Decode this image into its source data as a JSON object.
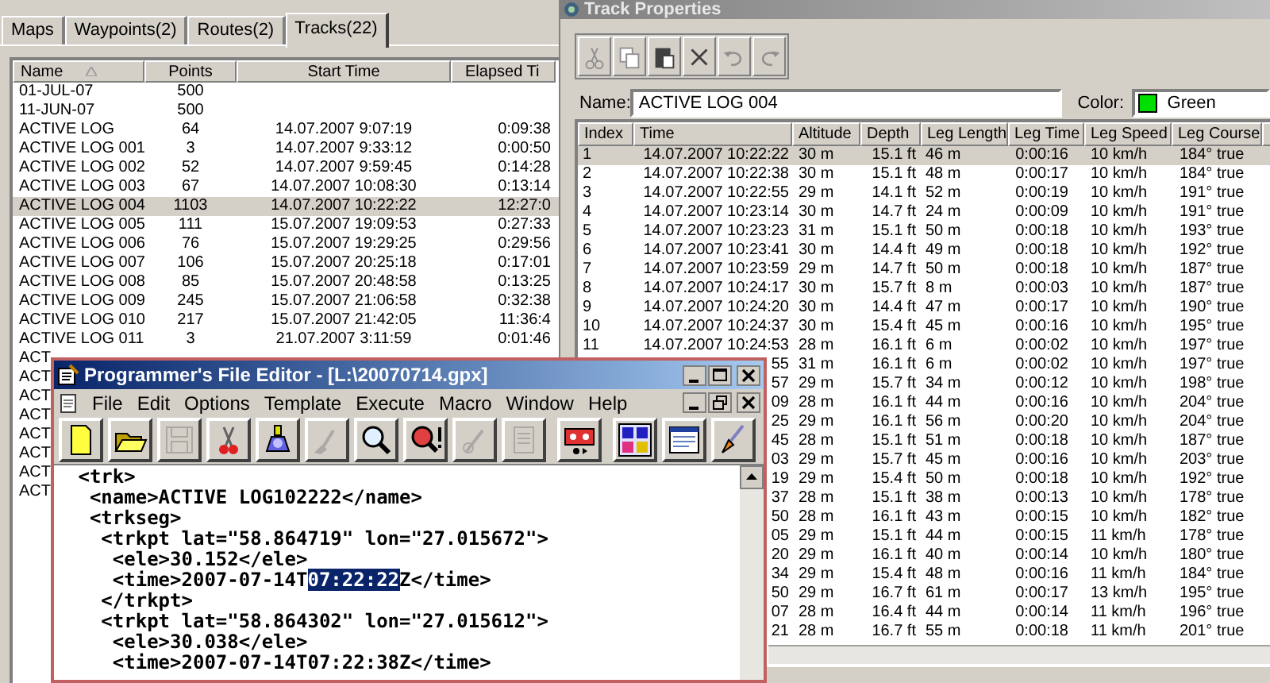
{
  "tracks_window": {
    "tabs": [
      {
        "label": "Maps",
        "selected": false
      },
      {
        "label": "Waypoints(2)",
        "selected": false
      },
      {
        "label": "Routes(2)",
        "selected": false
      },
      {
        "label": "Tracks(22)",
        "selected": true
      }
    ],
    "columns": [
      "Name",
      "Points",
      "Start Time",
      "Elapsed Ti"
    ],
    "rows": [
      {
        "name": "01-JUL-07",
        "points": "500",
        "selected": false
      },
      {
        "name": "11-JUN-07",
        "points": "500",
        "selected": false
      },
      {
        "name": "ACTIVE LOG",
        "points": "64",
        "start": "14.07.2007 9:07:19",
        "elapsed": "0:09:38",
        "selected": false
      },
      {
        "name": "ACTIVE LOG 001",
        "points": "3",
        "start": "14.07.2007 9:33:12",
        "elapsed": "0:00:50",
        "selected": false
      },
      {
        "name": "ACTIVE LOG 002",
        "points": "52",
        "start": "14.07.2007 9:59:45",
        "elapsed": "0:14:28",
        "selected": false
      },
      {
        "name": "ACTIVE LOG 003",
        "points": "67",
        "start": "14.07.2007 10:08:30",
        "elapsed": "0:13:14",
        "selected": false
      },
      {
        "name": "ACTIVE LOG 004",
        "points": "1103",
        "start": "14.07.2007 10:22:22",
        "elapsed": "12:27:0",
        "selected": true
      },
      {
        "name": "ACTIVE LOG 005",
        "points": "111",
        "start": "15.07.2007 19:09:53",
        "elapsed": "0:27:33",
        "selected": false
      },
      {
        "name": "ACTIVE LOG 006",
        "points": "76",
        "start": "15.07.2007 19:29:25",
        "elapsed": "0:29:56",
        "selected": false
      },
      {
        "name": "ACTIVE LOG 007",
        "points": "106",
        "start": "15.07.2007 20:25:18",
        "elapsed": "0:17:01",
        "selected": false
      },
      {
        "name": "ACTIVE LOG 008",
        "points": "85",
        "start": "15.07.2007 20:48:58",
        "elapsed": "0:13:25",
        "selected": false
      },
      {
        "name": "ACTIVE LOG 009",
        "points": "245",
        "start": "15.07.2007 21:06:58",
        "elapsed": "0:32:38",
        "selected": false
      },
      {
        "name": "ACTIVE LOG 010",
        "points": "217",
        "start": "15.07.2007 21:42:05",
        "elapsed": "11:36:4",
        "selected": false
      },
      {
        "name": "ACTIVE LOG 011",
        "points": "3",
        "start": "21.07.2007 3:11:59",
        "elapsed": "0:01:46",
        "selected": false
      },
      {
        "name": "ACT",
        "selected": false
      },
      {
        "name": "ACT",
        "selected": false
      },
      {
        "name": "ACT",
        "selected": false
      },
      {
        "name": "ACT",
        "selected": false
      },
      {
        "name": "ACT",
        "selected": false
      },
      {
        "name": "ACT",
        "selected": false
      },
      {
        "name": "ACT",
        "selected": false
      },
      {
        "name": "ACT",
        "selected": false
      }
    ]
  },
  "track_properties": {
    "title": "Track Properties",
    "toolbar": [
      {
        "kind": "cut",
        "disabled": true
      },
      {
        "kind": "copy",
        "disabled": true
      },
      {
        "kind": "paste",
        "disabled": false
      },
      {
        "kind": "delete",
        "disabled": false
      },
      {
        "kind": "undo",
        "disabled": true
      },
      {
        "kind": "redo",
        "disabled": true
      }
    ],
    "name_label": "Name:",
    "name_value": "ACTIVE LOG 004",
    "color_label": "Color:",
    "color_choice": {
      "label": "Green",
      "color": "#00e000"
    },
    "columns": [
      "Index",
      "Time",
      "Altitude",
      "Depth",
      "Leg Length",
      "Leg Time",
      "Leg Speed",
      "Leg Course"
    ],
    "rows": [
      {
        "index": "1",
        "time": "14.07.2007 10:22:22",
        "altitude": "30 m",
        "depth": "15.1 ft",
        "leg_length": "46 m",
        "leg_time": "0:00:16",
        "leg_speed": "10 km/h",
        "leg_course": "184° true",
        "selected": true
      },
      {
        "index": "2",
        "time": "14.07.2007 10:22:38",
        "altitude": "30 m",
        "depth": "15.1 ft",
        "leg_length": "48 m",
        "leg_time": "0:00:17",
        "leg_speed": "10 km/h",
        "leg_course": "184° true",
        "selected": false
      },
      {
        "index": "3",
        "time": "14.07.2007 10:22:55",
        "altitude": "29 m",
        "depth": "14.1 ft",
        "leg_length": "52 m",
        "leg_time": "0:00:19",
        "leg_speed": "10 km/h",
        "leg_course": "191° true",
        "selected": false
      },
      {
        "index": "4",
        "time": "14.07.2007 10:23:14",
        "altitude": "30 m",
        "depth": "14.7 ft",
        "leg_length": "24 m",
        "leg_time": "0:00:09",
        "leg_speed": "10 km/h",
        "leg_course": "191° true",
        "selected": false
      },
      {
        "index": "5",
        "time": "14.07.2007 10:23:23",
        "altitude": "31 m",
        "depth": "15.1 ft",
        "leg_length": "50 m",
        "leg_time": "0:00:18",
        "leg_speed": "10 km/h",
        "leg_course": "193° true",
        "selected": false
      },
      {
        "index": "6",
        "time": "14.07.2007 10:23:41",
        "altitude": "30 m",
        "depth": "14.4 ft",
        "leg_length": "49 m",
        "leg_time": "0:00:18",
        "leg_speed": "10 km/h",
        "leg_course": "192° true",
        "selected": false
      },
      {
        "index": "7",
        "time": "14.07.2007 10:23:59",
        "altitude": "29 m",
        "depth": "14.7 ft",
        "leg_length": "50 m",
        "leg_time": "0:00:18",
        "leg_speed": "10 km/h",
        "leg_course": "187° true",
        "selected": false
      },
      {
        "index": "8",
        "time": "14.07.2007 10:24:17",
        "altitude": "30 m",
        "depth": "15.7 ft",
        "leg_length": "8 m",
        "leg_time": "0:00:03",
        "leg_speed": "10 km/h",
        "leg_course": "187° true",
        "selected": false
      },
      {
        "index": "9",
        "time": "14.07.2007 10:24:20",
        "altitude": "30 m",
        "depth": "14.4 ft",
        "leg_length": "47 m",
        "leg_time": "0:00:17",
        "leg_speed": "10 km/h",
        "leg_course": "190° true",
        "selected": false
      },
      {
        "index": "10",
        "time": "14.07.2007 10:24:37",
        "altitude": "30 m",
        "depth": "15.4 ft",
        "leg_length": "45 m",
        "leg_time": "0:00:16",
        "leg_speed": "10 km/h",
        "leg_course": "195° true",
        "selected": false
      },
      {
        "index": "11",
        "time": "14.07.2007 10:24:53",
        "altitude": "28 m",
        "depth": "16.1 ft",
        "leg_length": "6 m",
        "leg_time": "0:00:02",
        "leg_speed": "10 km/h",
        "leg_course": "197° true",
        "selected": false
      },
      {
        "time": "55",
        "altitude": "31 m",
        "depth": "16.1 ft",
        "leg_length": "6 m",
        "leg_time": "0:00:02",
        "leg_speed": "10 km/h",
        "leg_course": "197° true",
        "selected": false
      },
      {
        "time": "57",
        "altitude": "29 m",
        "depth": "15.7 ft",
        "leg_length": "34 m",
        "leg_time": "0:00:12",
        "leg_speed": "10 km/h",
        "leg_course": "198° true",
        "selected": false
      },
      {
        "time": "09",
        "altitude": "28 m",
        "depth": "16.1 ft",
        "leg_length": "44 m",
        "leg_time": "0:00:16",
        "leg_speed": "10 km/h",
        "leg_course": "204° true",
        "selected": false
      },
      {
        "time": "25",
        "altitude": "29 m",
        "depth": "16.1 ft",
        "leg_length": "56 m",
        "leg_time": "0:00:20",
        "leg_speed": "10 km/h",
        "leg_course": "204° true",
        "selected": false
      },
      {
        "time": "45",
        "altitude": "28 m",
        "depth": "15.1 ft",
        "leg_length": "51 m",
        "leg_time": "0:00:18",
        "leg_speed": "10 km/h",
        "leg_course": "187° true",
        "selected": false
      },
      {
        "time": "03",
        "altitude": "29 m",
        "depth": "15.7 ft",
        "leg_length": "45 m",
        "leg_time": "0:00:16",
        "leg_speed": "10 km/h",
        "leg_course": "203° true",
        "selected": false
      },
      {
        "time": "19",
        "altitude": "29 m",
        "depth": "15.4 ft",
        "leg_length": "50 m",
        "leg_time": "0:00:18",
        "leg_speed": "10 km/h",
        "leg_course": "192° true",
        "selected": false
      },
      {
        "time": "37",
        "altitude": "28 m",
        "depth": "15.1 ft",
        "leg_length": "38 m",
        "leg_time": "0:00:13",
        "leg_speed": "10 km/h",
        "leg_course": "178° true",
        "selected": false
      },
      {
        "time": "50",
        "altitude": "28 m",
        "depth": "16.1 ft",
        "leg_length": "43 m",
        "leg_time": "0:00:15",
        "leg_speed": "10 km/h",
        "leg_course": "182° true",
        "selected": false
      },
      {
        "time": "05",
        "altitude": "29 m",
        "depth": "15.1 ft",
        "leg_length": "44 m",
        "leg_time": "0:00:15",
        "leg_speed": "11 km/h",
        "leg_course": "178° true",
        "selected": false
      },
      {
        "time": "20",
        "altitude": "29 m",
        "depth": "16.1 ft",
        "leg_length": "40 m",
        "leg_time": "0:00:14",
        "leg_speed": "10 km/h",
        "leg_course": "180° true",
        "selected": false
      },
      {
        "time": "34",
        "altitude": "29 m",
        "depth": "15.4 ft",
        "leg_length": "48 m",
        "leg_time": "0:00:16",
        "leg_speed": "11 km/h",
        "leg_course": "184° true",
        "selected": false
      },
      {
        "time": "50",
        "altitude": "29 m",
        "depth": "16.7 ft",
        "leg_length": "61 m",
        "leg_time": "0:00:17",
        "leg_speed": "13 km/h",
        "leg_course": "195° true",
        "selected": false
      },
      {
        "time": "07",
        "altitude": "28 m",
        "depth": "16.4 ft",
        "leg_length": "44 m",
        "leg_time": "0:00:14",
        "leg_speed": "11 km/h",
        "leg_course": "196° true",
        "selected": false
      },
      {
        "time": "21",
        "altitude": "28 m",
        "depth": "16.7 ft",
        "leg_length": "55 m",
        "leg_time": "0:00:18",
        "leg_speed": "11 km/h",
        "leg_course": "201° true",
        "selected": false
      }
    ]
  },
  "editor": {
    "title": "Programmer's File Editor - [L:\\20070714.gpx]",
    "menu": [
      "File",
      "Edit",
      "Options",
      "Template",
      "Execute",
      "Macro",
      "Window",
      "Help"
    ],
    "toolbar": [
      {
        "kind": "new",
        "disabled": false
      },
      {
        "kind": "open",
        "disabled": false
      },
      {
        "kind": "save",
        "disabled": true
      },
      {
        "kind": "cut",
        "disabled": false
      },
      {
        "kind": "device",
        "disabled": false
      },
      {
        "kind": "brush",
        "disabled": true
      },
      {
        "kind": "search",
        "disabled": false
      },
      {
        "kind": "search_next",
        "disabled": false
      },
      {
        "kind": "pen",
        "disabled": true
      },
      {
        "kind": "notes",
        "disabled": true
      },
      {
        "kind": "tape",
        "disabled": false
      },
      {
        "kind": "tiles",
        "disabled": false
      },
      {
        "kind": "window",
        "disabled": false
      },
      {
        "kind": "paintbrush",
        "disabled": false
      }
    ],
    "lines": [
      {
        "parts": [
          {
            "text": " <trk>",
            "selected": false
          }
        ]
      },
      {
        "parts": [
          {
            "text": "  <name>ACTIVE LOG102222</name>",
            "selected": false
          }
        ]
      },
      {
        "parts": [
          {
            "text": "  <trkseg>",
            "selected": false
          }
        ]
      },
      {
        "parts": [
          {
            "text": "   <trkpt lat=\"58.864719\" lon=\"27.015672\">",
            "selected": false
          }
        ]
      },
      {
        "parts": [
          {
            "text": "    <ele>30.152</ele>",
            "selected": false
          }
        ]
      },
      {
        "parts": [
          {
            "text": "    <time>2007-07-14T",
            "selected": false
          },
          {
            "text": "07:22:22",
            "selected": true
          },
          {
            "text": "Z</time>",
            "selected": false
          }
        ]
      },
      {
        "parts": [
          {
            "text": "   </trkpt>",
            "selected": false
          }
        ]
      },
      {
        "parts": [
          {
            "text": "   <trkpt lat=\"58.864302\" lon=\"27.015612\">",
            "selected": false
          }
        ]
      },
      {
        "parts": [
          {
            "text": "    <ele>30.038</ele>",
            "selected": false
          }
        ]
      },
      {
        "parts": [
          {
            "text": "    <time>2007-07-14T07:22:38Z</time>",
            "selected": false
          }
        ]
      }
    ]
  }
}
